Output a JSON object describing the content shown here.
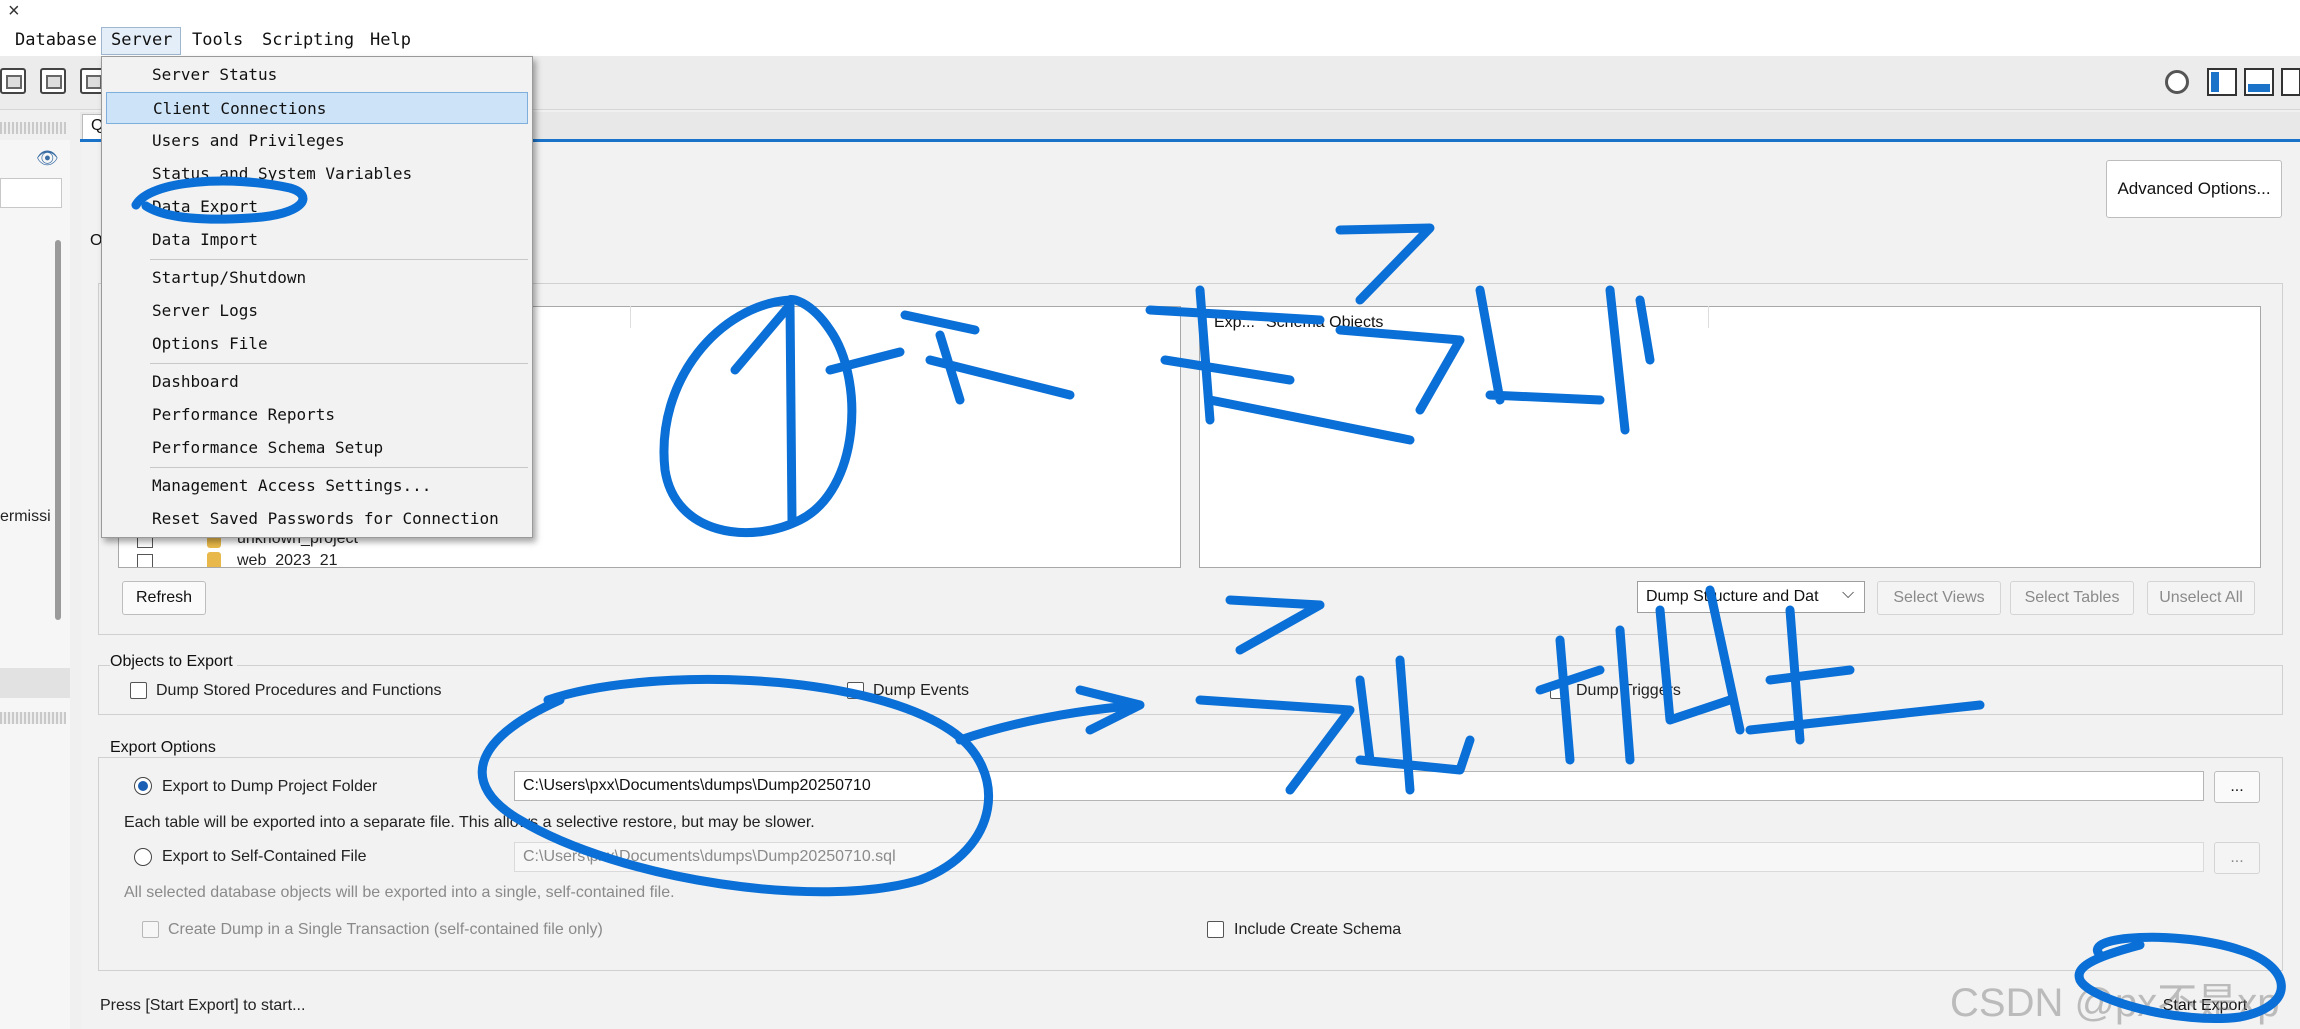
{
  "window": {
    "close_glyph": "×"
  },
  "menubar": {
    "items": [
      "Database",
      "Server",
      "Tools",
      "Scripting",
      "Help"
    ]
  },
  "toolbar": {
    "icons": [
      "new-connection-icon",
      "manage-connections-icon",
      "open-sql-icon"
    ]
  },
  "sidebar": {
    "partial_text": "ermissi",
    "eye_glyph": "👁"
  },
  "tabs": {
    "query_tab": "Q",
    "options_tab": "O"
  },
  "server_menu": {
    "items": [
      "Server Status",
      "Client Connections",
      "Users and Privileges",
      "Status and System Variables",
      "Data Export",
      "Data Import",
      "Startup/Shutdown",
      "Server Logs",
      "Options File",
      "Dashboard",
      "Performance Reports",
      "Performance Schema Setup",
      "Management Access Settings...",
      "Reset Saved Passwords for Connection"
    ],
    "active_index": 1
  },
  "export_page": {
    "advanced_button": "Advanced Options...",
    "schema_rows": [
      "unknown_project",
      "web_2023_21"
    ],
    "objects_header_1": "Exp...",
    "objects_header_2": "Schema Objects",
    "refresh_button": "Refresh",
    "dump_select_value": "Dump Structure and Dat",
    "select_views_button": "Select Views",
    "select_tables_button": "Select Tables",
    "unselect_button": "Unselect All",
    "objects_group_title": "Objects to Export",
    "dump_procs_label": "Dump Stored Procedures and Functions",
    "dump_events_label": "Dump Events",
    "dump_triggers_label": "Dump Triggers",
    "export_group_title": "Export Options",
    "export_folder_label": "Export to Dump Project Folder",
    "export_folder_path": "C:\\Users\\pxx\\Documents\\dumps\\Dump20250710",
    "browse_label": "...",
    "folder_hint": "Each table will be exported into a separate file. This allows a selective restore, but may be slower.",
    "export_file_label": "Export to Self-Contained File",
    "export_file_path": "C:\\Users\\pxx\\Documents\\dumps\\Dump20250710.sql",
    "file_hint": "All selected database objects will be exported into a single, self-contained file.",
    "single_txn_label": "Create Dump in a Single Transaction (self-contained file only)",
    "include_schema_label": "Include Create Schema",
    "status_text": "Press [Start Export] to start...",
    "start_button": "Start Export"
  },
  "annotations": {
    "note_1": "①选表导出",
    "note_2": "导出地址",
    "ink_color": "#0a6fd6"
  },
  "watermark": "CSDN @px不是xp"
}
